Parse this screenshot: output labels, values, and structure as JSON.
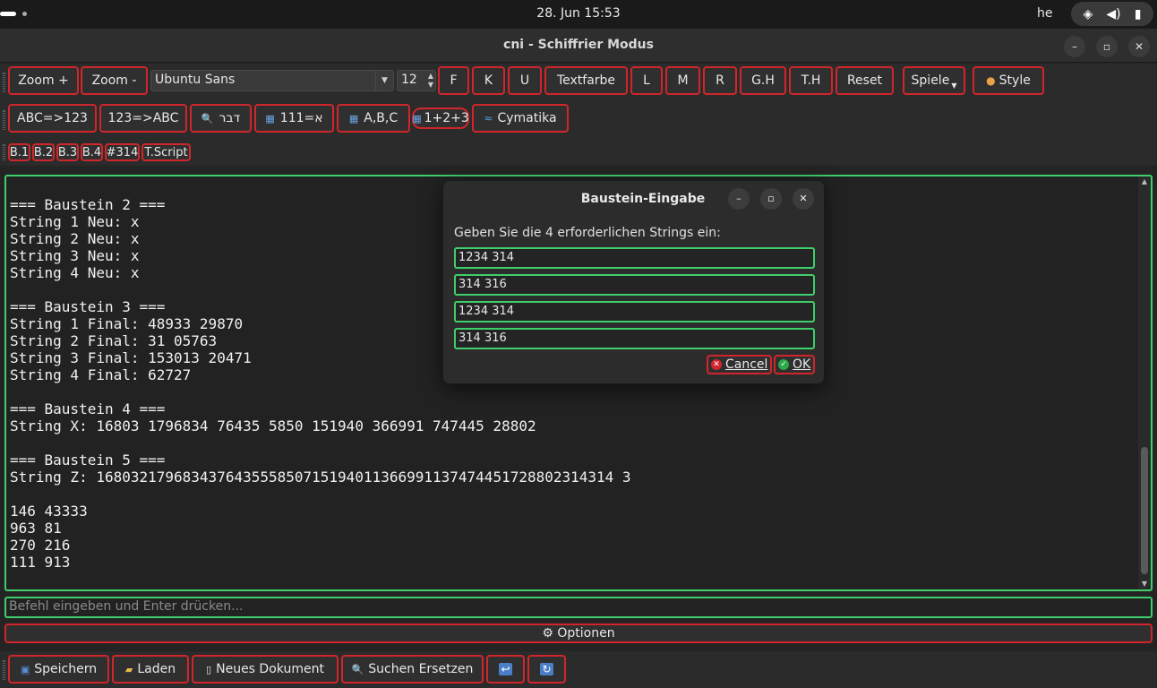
{
  "system": {
    "clock": "28. Jun  15:53",
    "keyboard_layout": "he",
    "tray_icons": [
      "wifi-icon",
      "volume-icon",
      "battery-icon"
    ]
  },
  "window": {
    "title": "cni - Schiffrier Modus",
    "controls": [
      "minimize",
      "maximize",
      "close"
    ]
  },
  "toolbar1": {
    "zoom_in": "Zoom +",
    "zoom_out": "Zoom -",
    "font_family": "Ubuntu Sans",
    "font_size": "12",
    "bold": "F",
    "italic": "K",
    "underline": "U",
    "text_color": "Textfarbe",
    "align_left": "L",
    "align_center": "M",
    "align_right": "R",
    "g_h": "G.H",
    "t_h": "T.H",
    "reset": "Reset",
    "games": "Spiele",
    "style": "Style"
  },
  "toolbar2": {
    "abc_to_num": "ABC=>123",
    "num_to_abc": "123=>ABC",
    "search_dvr": "דבר",
    "hebrew_111": "111=א",
    "abc_list": "A,B,C",
    "sum": "1+2+3",
    "cymatika": "Cymatika"
  },
  "toolbar3": {
    "b1": "B.1",
    "b2": "B.2",
    "b3": "B.3",
    "b4": "B.4",
    "n314": "#314",
    "tscript": "T.Script"
  },
  "editor": {
    "lines": [
      "=== Baustein 2 ===",
      "String 1 Neu: x",
      "String 2 Neu: x",
      "String 3 Neu: x",
      "String 4 Neu: x",
      "",
      "=== Baustein 3 ===",
      "String 1 Final: 48933 29870",
      "String 2 Final: 31 05763",
      "String 3 Final: 153013 20471",
      "String 4 Final: 62727",
      "",
      "=== Baustein 4 ===",
      "String X: 16803 1796834 76435 5850 151940 366991 747445 28802",
      "",
      "=== Baustein 5 ===",
      "String Z: 168032179683437643555850715194011366991137474451728802314314 3",
      "",
      "146 43333",
      "963 81",
      "270 216",
      "111 913"
    ]
  },
  "command_placeholder": "Befehl eingeben und Enter drücken...",
  "options_label": "⚙ Optionen",
  "bottom_toolbar": {
    "save": "Speichern",
    "load": "Laden",
    "new_doc": "Neues Dokument",
    "search_replace": "Suchen  Ersetzen"
  },
  "dialog": {
    "title": "Baustein-Eingabe",
    "prompt": "Geben Sie die 4 erforderlichen Strings ein:",
    "fields": [
      "1234 314",
      "314 316",
      "1234 314",
      "314 316"
    ],
    "cancel": "Cancel",
    "ok": "OK"
  }
}
